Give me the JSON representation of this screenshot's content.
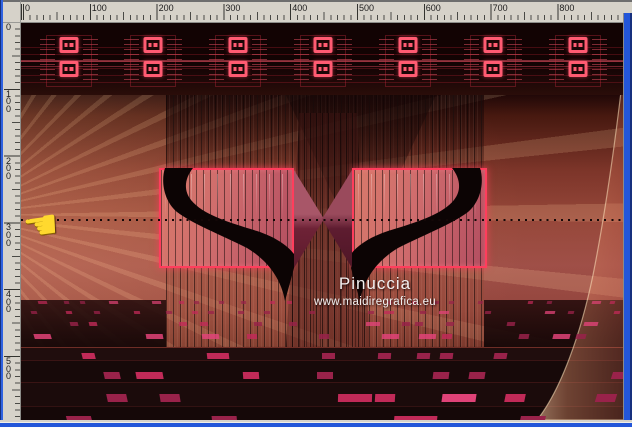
{
  "window": {
    "border_color": "#2356d9",
    "ruler_bg_color": "#d6d2c9"
  },
  "rulers": {
    "horizontal": {
      "labels": [
        "0",
        "100",
        "200",
        "300",
        "400",
        "500",
        "600",
        "700",
        "800"
      ]
    },
    "vertical": {
      "labels": [
        "0",
        "100",
        "200",
        "300",
        "400",
        "500"
      ]
    }
  },
  "artwork": {
    "credit_name": "Pinuccia",
    "credit_url": "www.maidiregrafica.eu",
    "hand_icon": "☚",
    "colors": {
      "accent_pink": "#ff3d5c",
      "tile_pink": "#c12a58",
      "ray_orange": "#d2825c",
      "dark_bg": "#150708",
      "hand_yellow": "#ffd92e"
    }
  },
  "ornaments": {
    "count": 7
  }
}
